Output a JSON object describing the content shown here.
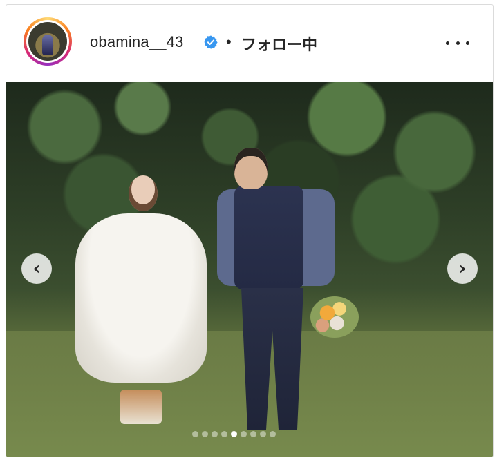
{
  "post": {
    "username": "obamina__43",
    "separator": "•",
    "follow_status": "フォロー中",
    "verified": true
  },
  "icons": {
    "verified": "verified-badge-icon",
    "more": "more-options-icon",
    "prev": "chevron-left-icon",
    "next": "chevron-right-icon"
  },
  "carousel": {
    "total_slides": 9,
    "current_slide": 5,
    "prev_glyph": "‹",
    "next_glyph": "›"
  },
  "colors": {
    "verified_blue": "#3897f0",
    "text": "#262626"
  }
}
